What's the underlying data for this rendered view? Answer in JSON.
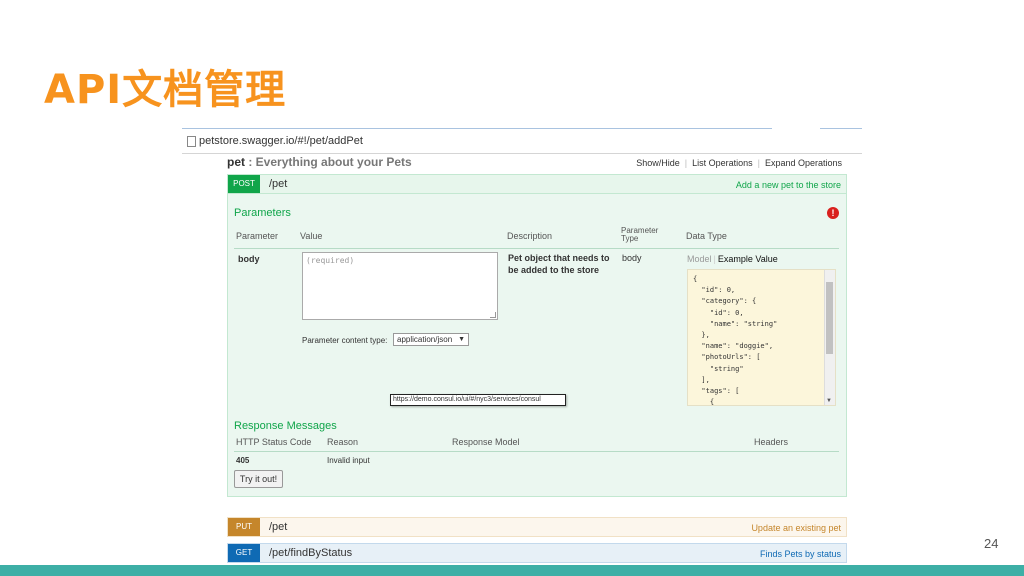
{
  "slide": {
    "title": "API文档管理",
    "page_number": "24"
  },
  "browser": {
    "url": "petstore.swagger.io/#!/pet/addPet"
  },
  "resource": {
    "name": "pet",
    "separator": " : ",
    "description": "Everything about your Pets",
    "links": [
      "Show/Hide",
      "List Operations",
      "Expand Operations"
    ]
  },
  "operations": {
    "post": {
      "method": "POST",
      "path": "/pet",
      "summary": "Add a new pet to the store"
    },
    "put": {
      "method": "PUT",
      "path": "/pet",
      "summary": "Update an existing pet"
    },
    "get": {
      "method": "GET",
      "path": "/pet/findByStatus",
      "summary": "Finds Pets by status"
    }
  },
  "parameters": {
    "heading": "Parameters",
    "headers": {
      "parameter": "Parameter",
      "value": "Value",
      "description": "Description",
      "param_type": "Parameter\nType",
      "data_type": "Data Type"
    },
    "row": {
      "name": "body",
      "placeholder": "(required)",
      "description": "Pet object that needs to be added to the store",
      "param_type": "body"
    },
    "content_type_label": "Parameter content type:",
    "content_type_value": "application/json",
    "model_tab": "Model",
    "example_tab": "Example Value",
    "example_json": "{\n  \"id\": 0,\n  \"category\": {\n    \"id\": 0,\n    \"name\": \"string\"\n  },\n  \"name\": \"doggie\",\n  \"photoUrls\": [\n    \"string\"\n  ],\n  \"tags\": [\n    {"
  },
  "tooltip": "https://demo.consul.io/ui/#/nyc3/services/consul",
  "responses": {
    "heading": "Response Messages",
    "headers": {
      "status": "HTTP Status Code",
      "reason": "Reason",
      "model": "Response Model",
      "headers": "Headers"
    },
    "row": {
      "status": "405",
      "reason": "Invalid input"
    }
  },
  "try_button": "Try it out!",
  "colors": {
    "title": "#f7931e",
    "post": "#10a54a",
    "put": "#c5862b",
    "get": "#0f6ab4",
    "accent_bar": "#3dafa6",
    "error": "#d9211e"
  }
}
